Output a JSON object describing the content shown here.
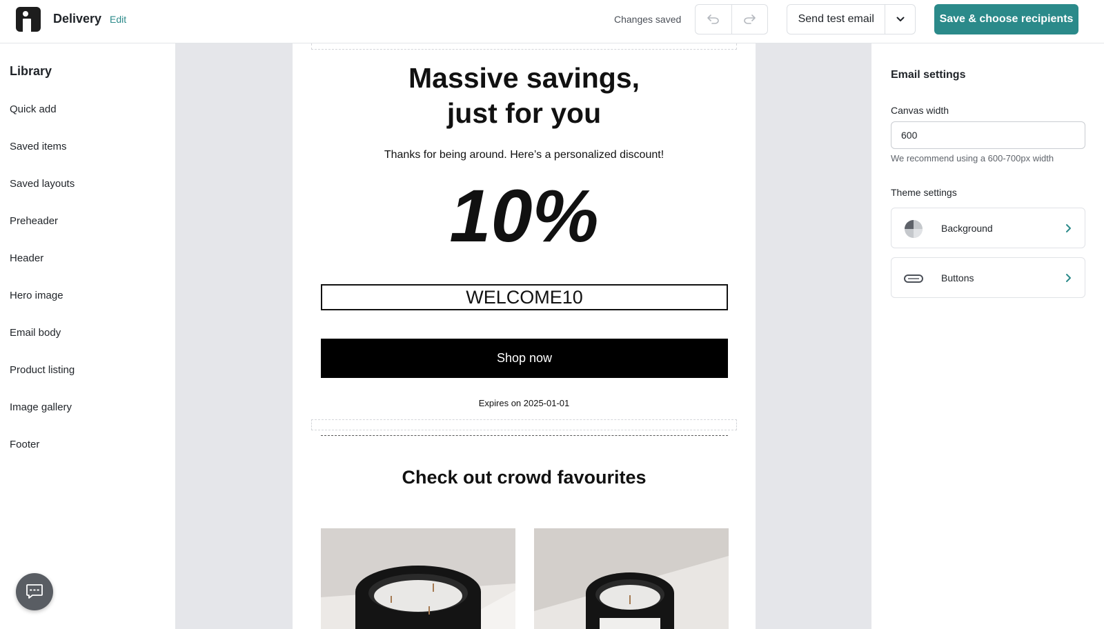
{
  "header": {
    "app_title": "Delivery",
    "edit_label": "Edit",
    "status": "Changes saved",
    "undo_icon": "undo-icon",
    "redo_icon": "redo-icon",
    "send_test_label": "Send test email",
    "save_label": "Save & choose recipients"
  },
  "library": {
    "title": "Library",
    "items": [
      {
        "label": "Quick add"
      },
      {
        "label": "Saved items"
      },
      {
        "label": "Saved layouts"
      },
      {
        "label": "Preheader"
      },
      {
        "label": "Header"
      },
      {
        "label": "Hero image"
      },
      {
        "label": "Email body"
      },
      {
        "label": "Product listing"
      },
      {
        "label": "Image gallery"
      },
      {
        "label": "Footer"
      }
    ]
  },
  "email": {
    "headline_line1": "Massive savings,",
    "headline_line2": "just for you",
    "subline": "Thanks for being around. Here’s a personalized discount!",
    "discount": "10%",
    "code": "WELCOME10",
    "cta": "Shop now",
    "expires": "Expires on 2025-01-01",
    "section_title": "Check out crowd favourites"
  },
  "settings": {
    "title": "Email settings",
    "canvas_width_label": "Canvas width",
    "canvas_width_value": "600",
    "canvas_width_hint": "We recommend using a 600-700px width",
    "theme_label": "Theme settings",
    "theme_items": [
      {
        "label": "Background",
        "icon": "background-icon"
      },
      {
        "label": "Buttons",
        "icon": "buttons-icon"
      }
    ]
  },
  "colors": {
    "accent": "#2b8a8a",
    "canvas_bg": "#e5e6ea",
    "cta_bg": "#000000"
  }
}
